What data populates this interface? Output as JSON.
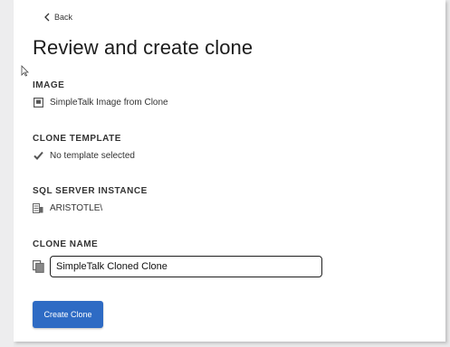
{
  "nav": {
    "back_label": "Back"
  },
  "page": {
    "title": "Review and create clone"
  },
  "sections": {
    "image": {
      "label": "IMAGE",
      "value": "SimpleTalk Image from Clone",
      "icon": "image-icon"
    },
    "clone_template": {
      "label": "CLONE TEMPLATE",
      "value": "No template selected",
      "icon": "check-icon"
    },
    "sql_server_instance": {
      "label": "SQL SERVER INSTANCE",
      "value": "ARISTOTLE\\",
      "icon": "server-icon"
    },
    "clone_name": {
      "label": "CLONE NAME",
      "value": "SimpleTalk Cloned Clone",
      "icon": "copy-icon"
    }
  },
  "actions": {
    "create_label": "Create Clone"
  },
  "colors": {
    "primary_button": "#2e6bc4",
    "background": "#ffffff",
    "outer_background": "#e9e9ea"
  }
}
